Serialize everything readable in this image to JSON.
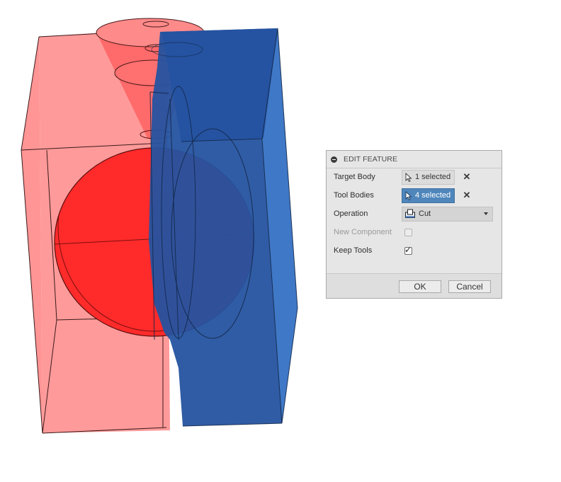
{
  "viewport": {
    "colors": {
      "target_body": "#ff3b3b",
      "tool_bodies": "#2e5fb0"
    }
  },
  "panel": {
    "title": "EDIT FEATURE",
    "rows": {
      "target_body": {
        "label": "Target Body",
        "value": "1 selected"
      },
      "tool_bodies": {
        "label": "Tool Bodies",
        "value": "4 selected"
      },
      "operation": {
        "label": "Operation",
        "value": "Cut"
      },
      "new_component": {
        "label": "New Component",
        "checked": false,
        "enabled": false
      },
      "keep_tools": {
        "label": "Keep Tools",
        "checked": true
      }
    },
    "ok_label": "OK",
    "cancel_label": "Cancel",
    "accent": "#4f86bb"
  }
}
